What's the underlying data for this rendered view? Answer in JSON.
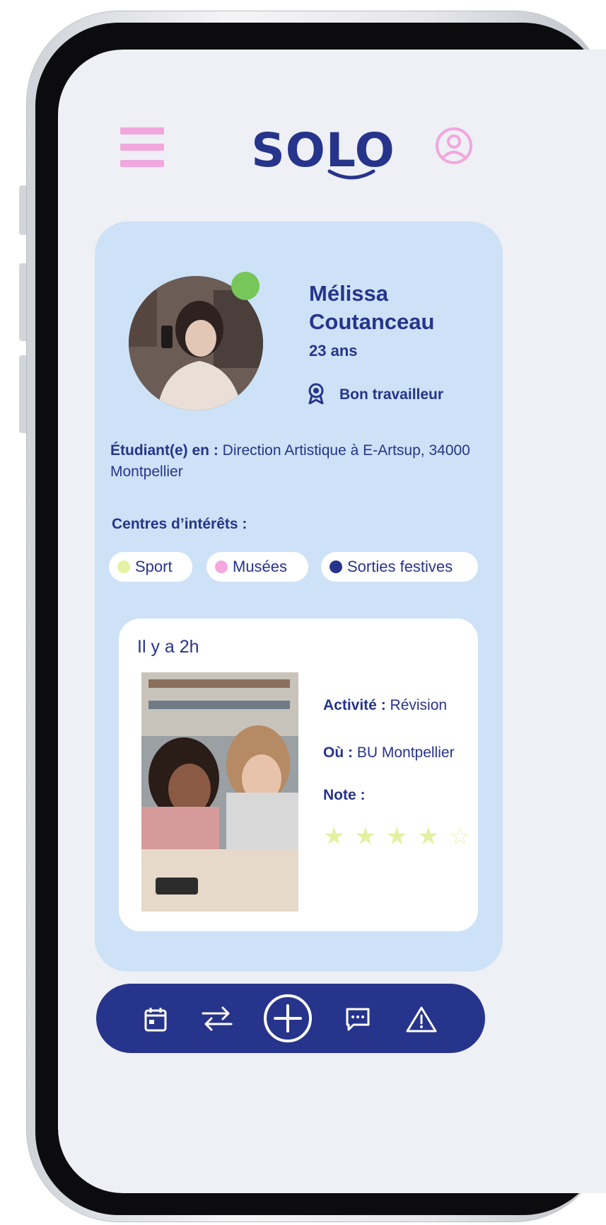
{
  "header": {
    "logo_text": "SOLO",
    "menu_icon": "hamburger-menu-icon",
    "profile_icon": "user-circle-icon"
  },
  "profile": {
    "name": "Mélissa Coutanceau",
    "age": "23 ans",
    "online": true,
    "badge_label": "Bon travailleur",
    "badge_icon": "award-ribbon-icon",
    "study_label": "Étudiant(e) en :",
    "study_value": "Direction Artistique à E-Artsup, 34000 Montpellier",
    "interests_label": "Centres d’intérêts :",
    "interests": [
      {
        "label": "Sport",
        "color": "#e4f3a3"
      },
      {
        "label": "Musées",
        "color": "#f4a8dd"
      },
      {
        "label": "Sorties festives",
        "color": "#27348b"
      }
    ]
  },
  "activity": {
    "time_ago": "Il y a 2h",
    "activity_label": "Activité :",
    "activity_value": "Révision",
    "where_label": "Où :",
    "where_value": "BU Montpellier",
    "rating_label": "Note :",
    "rating": 4.5,
    "rating_max": 5
  },
  "bottom_nav": [
    {
      "icon": "calendar-icon"
    },
    {
      "icon": "swap-arrows-icon"
    },
    {
      "icon": "add-circle-icon"
    },
    {
      "icon": "chat-bubble-icon"
    },
    {
      "icon": "warning-triangle-icon"
    }
  ],
  "colors": {
    "primary": "#27348b",
    "card_bg": "#cde2f6",
    "accent_pink": "#f1a7dc",
    "accent_lime": "#e3f0a2",
    "online_green": "#77c65a"
  }
}
